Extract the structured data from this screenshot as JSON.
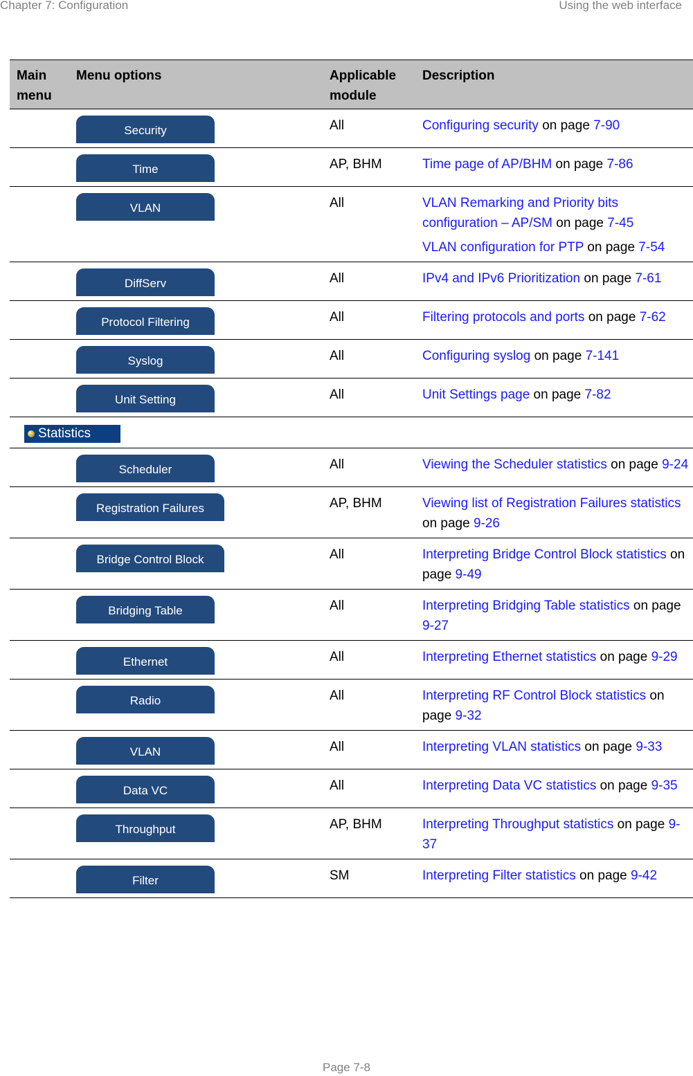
{
  "header": {
    "left": "Chapter 7:  Configuration",
    "right": "Using the web interface"
  },
  "footer": {
    "page": "Page 7-8"
  },
  "table": {
    "columns": [
      "Main menu",
      "Menu options",
      "Applicable module",
      "Description"
    ],
    "rows": [
      {
        "option": "Security",
        "module": "All",
        "desc": [
          {
            "link": "Configuring security",
            "mid": " on page ",
            "page": "7-90"
          }
        ]
      },
      {
        "option": "Time",
        "module": "AP, BHM",
        "desc": [
          {
            "link": "Time page of AP/BHM",
            "mid": " on page ",
            "page": "7-86"
          }
        ]
      },
      {
        "option": "VLAN",
        "module": "All",
        "desc": [
          {
            "link": "VLAN Remarking and Priority bits configuration – AP/SM",
            "mid": " on page ",
            "page": "7-45"
          },
          {
            "link": "VLAN configuration for PTP",
            "mid": " on page ",
            "page": "7-54"
          }
        ]
      },
      {
        "option": "DiffServ",
        "module": "All",
        "desc": [
          {
            "link": "IPv4 and IPv6 Prioritization",
            "mid": " on page ",
            "page": "7-61"
          }
        ]
      },
      {
        "option": "Protocol Filtering",
        "module": "All",
        "desc": [
          {
            "link": "Filtering protocols and ports",
            "mid": " on page ",
            "page": "7-62"
          }
        ]
      },
      {
        "option": "Syslog",
        "module": "All",
        "desc": [
          {
            "link": "Configuring syslog",
            "mid": " on page ",
            "page": "7-141"
          }
        ]
      },
      {
        "option": "Unit Setting",
        "module": "All",
        "desc": [
          {
            "link": "Unit Settings page",
            "mid": " on page ",
            "page": "7-82"
          }
        ]
      }
    ],
    "main_menu_statistics": {
      "label": "Statistics",
      "icon": "bullet-dot-icon"
    },
    "stat_rows": [
      {
        "option": "Scheduler",
        "module": "All",
        "desc": [
          {
            "link": "Viewing the Scheduler statistics",
            "mid": " on page ",
            "page": "9-24"
          }
        ]
      },
      {
        "option": "Registration Failures",
        "module": "AP, BHM",
        "desc": [
          {
            "link": "Viewing list of Registration Failures statistics",
            "mid": " on page ",
            "page": "9-26"
          }
        ]
      },
      {
        "option": "Bridge Control Block",
        "module": "All",
        "desc": [
          {
            "link": "Interpreting Bridge Control Block statistics",
            "mid": " on page ",
            "page": "9-49"
          }
        ]
      },
      {
        "option": "Bridging Table",
        "module": "All",
        "desc": [
          {
            "link": "Interpreting Bridging Table statistics",
            "mid": " on page ",
            "page": "9-27"
          }
        ]
      },
      {
        "option": "Ethernet",
        "module": "All",
        "desc": [
          {
            "link": "Interpreting Ethernet statistics",
            "mid": " on page ",
            "page": "9-29"
          }
        ]
      },
      {
        "option": "Radio",
        "module": "All",
        "desc": [
          {
            "link": "Interpreting RF Control Block statistics",
            "mid": " on page ",
            "page": "9-32"
          }
        ]
      },
      {
        "option": "VLAN",
        "module": "All",
        "desc": [
          {
            "link": "Interpreting VLAN statistics",
            "mid": " on page ",
            "page": "9-33"
          }
        ]
      },
      {
        "option": "Data VC",
        "module": "All",
        "desc": [
          {
            "link": "Interpreting Data VC statistics",
            "mid": " on page ",
            "page": "9-35"
          }
        ]
      },
      {
        "option": "Throughput",
        "module": "AP, BHM",
        "desc": [
          {
            "link": "Interpreting Throughput statistics",
            "mid": " on page ",
            "page": "9-37"
          }
        ]
      },
      {
        "option": "Filter",
        "module": "SM",
        "desc": [
          {
            "link": "Interpreting Filter statistics",
            "mid": " on page ",
            "page": "9-42"
          }
        ]
      }
    ]
  },
  "colors": {
    "button_bg": "#224a7c",
    "link": "#1a1aff",
    "header_bg": "#c0c0c0",
    "stat_menu_bg": "#0d3f80"
  }
}
